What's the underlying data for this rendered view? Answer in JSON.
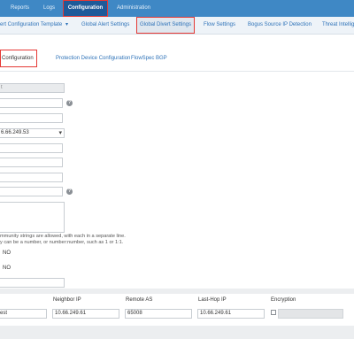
{
  "topnav": {
    "items": [
      "Reports",
      "Logs",
      "Configuration",
      "Administration"
    ],
    "active": "Configuration"
  },
  "subnav": {
    "items": [
      "ert Configuration Template",
      "Global Alert Settings",
      "Global Divert Settings",
      "Flow Settings",
      "Bogus Source IP Detection",
      "Threat Intellig"
    ],
    "dropdown_caret": "▾"
  },
  "tabs": [
    "Configuration",
    "Protection Device Configuration",
    "FlowSpec BGP"
  ],
  "form": {
    "field1_value": "t",
    "select_value": "6.66.249.53",
    "help_glyph": "?",
    "note_line1": "mmunity strings are allowed, with each in a separate line.",
    "note_line2": "y can be a number, or number:number, such as 1 or 1:1.",
    "radio1_label": "NO",
    "radio2_label": "NO"
  },
  "neighbors": {
    "columns": [
      "Neighbor IP",
      "Remote AS",
      "Last-Hop IP",
      "Encryption"
    ],
    "row": {
      "name_fragment": "est",
      "neighbor_ip": "10.66.249.61",
      "remote_as": "65008",
      "last_hop_ip": "10.66.249.61"
    }
  },
  "colors": {
    "nav_bg": "#3f88c5",
    "nav_active_bg": "#1e5a99",
    "highlight_outline": "#e53935",
    "link": "#2d72b8"
  }
}
